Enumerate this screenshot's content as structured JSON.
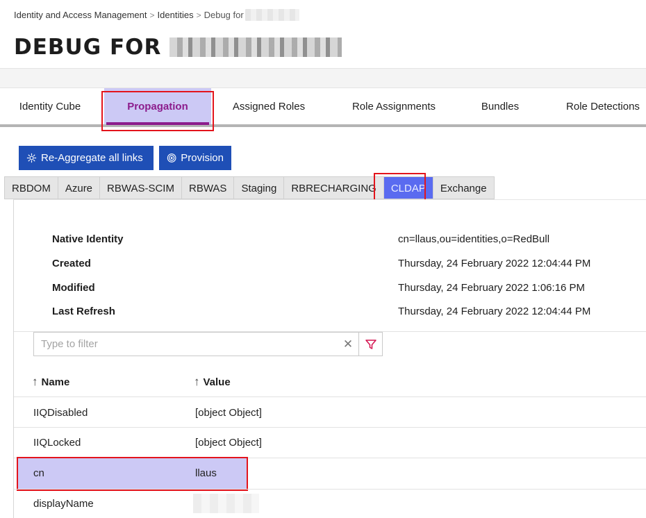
{
  "breadcrumb": {
    "item1": "Identity and Access Management",
    "item2": "Identities",
    "current": "Debug for"
  },
  "page": {
    "title": "DEBUG FOR"
  },
  "tabs": [
    {
      "label": "Identity Cube",
      "active": false
    },
    {
      "label": "Propagation",
      "active": true
    },
    {
      "label": "Assigned Roles",
      "active": false
    },
    {
      "label": "Role Assignments",
      "active": false
    },
    {
      "label": "Bundles",
      "active": false
    },
    {
      "label": "Role Detections",
      "active": false
    }
  ],
  "actions": {
    "reaggregate_label": "Re-Aggregate all links",
    "provision_label": "Provision"
  },
  "applications": [
    {
      "label": "RBDOM",
      "active": false
    },
    {
      "label": "Azure",
      "active": false
    },
    {
      "label": "RBWAS-SCIM",
      "active": false
    },
    {
      "label": "RBWAS",
      "active": false
    },
    {
      "label": "Staging",
      "active": false
    },
    {
      "label": "RBRECHARGING",
      "active": false
    },
    {
      "label": "CLDAP",
      "active": true
    },
    {
      "label": "Exchange",
      "active": false
    }
  ],
  "summary": [
    {
      "label": "Native Identity",
      "value": "cn=llaus,ou=identities,o=RedBull"
    },
    {
      "label": "Created",
      "value": "Thursday, 24 February 2022 12:04:44 PM"
    },
    {
      "label": "Modified",
      "value": "Thursday, 24 February 2022 1:06:16 PM"
    },
    {
      "label": "Last Refresh",
      "value": "Thursday, 24 February 2022 12:04:44 PM"
    }
  ],
  "filter": {
    "placeholder": "Type to filter",
    "value": ""
  },
  "table": {
    "columns": [
      "Name",
      "Value"
    ],
    "rows": [
      {
        "name": "IIQDisabled",
        "value": "[object Object]"
      },
      {
        "name": "IIQLocked",
        "value": "[object Object]"
      },
      {
        "name": "cn",
        "value": "llaus"
      },
      {
        "name": "displayName",
        "value": ""
      }
    ]
  },
  "colors": {
    "accent": "#8c1c8c",
    "tab_active_bg": "#ccc9f5",
    "primary_button": "#1f4fb6",
    "app_tab_active": "#5a6bf0",
    "highlight_outline": "#e3141c"
  }
}
